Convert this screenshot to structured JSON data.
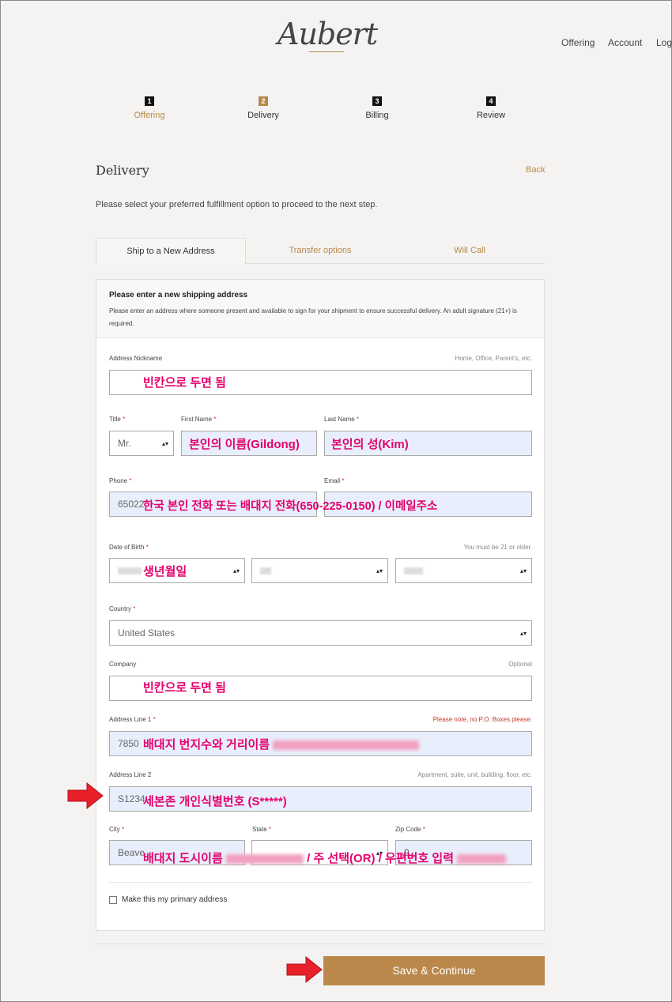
{
  "brand": {
    "logo_text": "Aubert"
  },
  "nav": {
    "offering": "Offering",
    "account": "Account",
    "login": "Log"
  },
  "steps": [
    {
      "num": "1",
      "label": "Offering"
    },
    {
      "num": "2",
      "label": "Delivery"
    },
    {
      "num": "3",
      "label": "Billing"
    },
    {
      "num": "4",
      "label": "Review"
    }
  ],
  "page": {
    "title": "Delivery",
    "back": "Back",
    "intro": "Please select your preferred fulfillment option to proceed to the next step."
  },
  "tabs": [
    {
      "label": "Ship to a New Address",
      "active": true
    },
    {
      "label": "Transfer options",
      "active": false
    },
    {
      "label": "Will Call",
      "active": false
    }
  ],
  "panel": {
    "title": "Please enter a new shipping address",
    "description": "Please enter an address where someone present and available to sign for your shipment to ensure successful delivery. An adult signature (21+) is required."
  },
  "form": {
    "nickname": {
      "label": "Address Nickname",
      "hint": "Home, Office, Parent's, etc.",
      "value": ""
    },
    "title": {
      "label": "Title",
      "required": "*",
      "value": "Mr."
    },
    "first_name": {
      "label": "First Name",
      "required": "*"
    },
    "last_name": {
      "label": "Last Name",
      "required": "*"
    },
    "phone": {
      "label": "Phone",
      "required": "*",
      "value": "65022"
    },
    "email": {
      "label": "Email",
      "required": "*"
    },
    "dob": {
      "label": "Date of Birth",
      "required": "*",
      "hint": "You must be 21 or older."
    },
    "country": {
      "label": "Country",
      "required": "*",
      "value": "United States"
    },
    "company": {
      "label": "Company",
      "hint": "Optional"
    },
    "address1": {
      "label": "Address Line 1",
      "required": "*",
      "hint": "Please note, no P.O. Boxes please.",
      "value": "7850"
    },
    "address2": {
      "label": "Address Line 2",
      "hint": "Apartment, suite, unit, building, floor, etc.",
      "value": "S1234"
    },
    "city": {
      "label": "City",
      "required": "*",
      "value": "Beave"
    },
    "state": {
      "label": "State",
      "required": "*"
    },
    "zip": {
      "label": "Zip Code",
      "required": "*",
      "value": "9"
    },
    "primary": {
      "label": "Make this my primary address"
    }
  },
  "save_button": "Save & Continue",
  "annotations": {
    "nickname": "빈칸으로 두면 됨",
    "first_name": "본인의 이름(Gildong)",
    "last_name": "본인의 성(Kim)",
    "phone_email": "한국 본인 전화 또는 배대지 전화(650-225-0150)    /    이메일주소",
    "dob": "생년월일",
    "company": "빈칸으로 두면 됨",
    "address1": "배대지 번지수와 거리이름",
    "address2": "세본존 개인식별번호 (S*****)",
    "city_state_zip": "배대지 도시이름",
    "city_state_zip_2": "/ 주 선택(OR) / 우편번호 입력"
  },
  "colors": {
    "accent": "#b9884a",
    "annotation": "#e4006d",
    "arrow": "#e8202a",
    "autofill": "#e8eefb"
  }
}
